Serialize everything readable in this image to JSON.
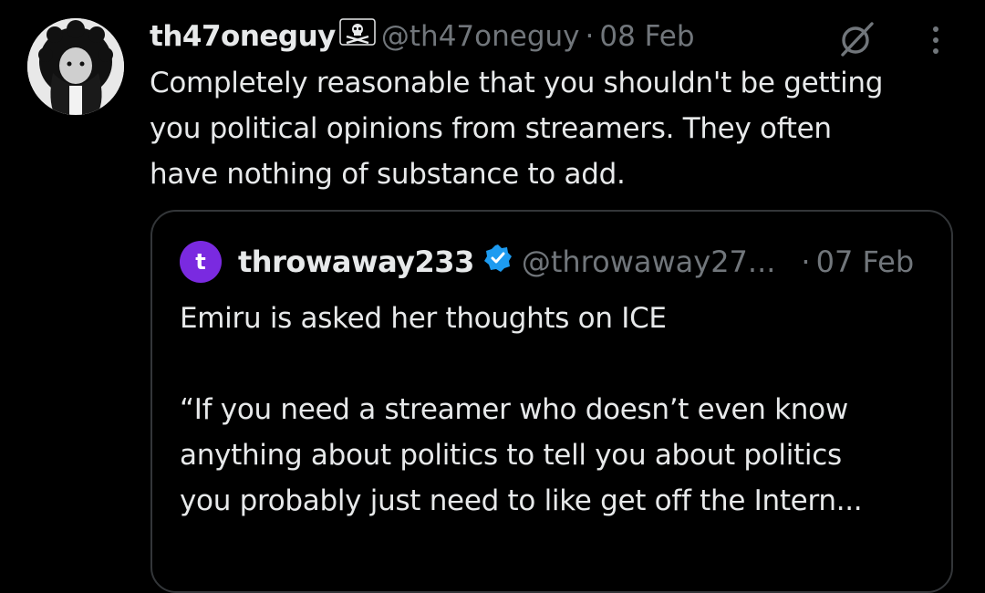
{
  "post": {
    "author": {
      "display_name": "th47oneguy",
      "badge_icon": "skull-crossbones-icon",
      "handle": "@th47oneguy",
      "avatar_icon": "avatar-curly-hair-drawing"
    },
    "separator": "·",
    "date": "08 Feb",
    "text": "Completely reasonable that you shouldn't be getting\nyou political opinions from streamers. They often\nhave nothing of substance to add."
  },
  "actions": {
    "grok_icon": "grok-slash-icon",
    "more_icon": "more-vertical-icon"
  },
  "quoted_post": {
    "avatar_letter": "t",
    "avatar_color": "#7a2ae0",
    "display_name": "throwaway233",
    "verified_icon": "verified-badge-icon",
    "verified_color": "#1d9bf0",
    "handle": "@throwaway27...",
    "separator": "·",
    "date": "07 Feb",
    "text": "Emiru is asked her thoughts on ICE\n\n“If you need a streamer who doesn’t even know\nanything about politics to tell you about politics\nyou probably just need to like get off the Intern..."
  },
  "theme": {
    "background": "#000000",
    "text_primary": "#e7e9ea",
    "text_secondary": "#71767b",
    "border": "#333639"
  }
}
